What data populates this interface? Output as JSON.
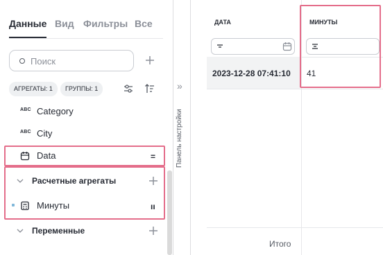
{
  "left_panel": {
    "tabs": [
      {
        "label": "Данные",
        "active": true
      },
      {
        "label": "Вид",
        "active": false
      },
      {
        "label": "Фильтры",
        "active": false
      },
      {
        "label": "Все",
        "active": false
      }
    ],
    "search": {
      "placeholder": "Поиск",
      "value": ""
    },
    "chips": [
      {
        "label": "АГРЕГАТЫ: 1"
      },
      {
        "label": "ГРУППЫ: 1"
      }
    ],
    "fields": [
      {
        "type_badge": "ABC",
        "label": "Category"
      },
      {
        "type_badge": "ABC",
        "label": "City"
      }
    ],
    "date_field": {
      "icon": "calendar-icon",
      "label": "Data",
      "mark": "="
    },
    "groups": {
      "calculated": {
        "label": "Расчетные агрегаты"
      },
      "variables": {
        "label": "Переменные"
      }
    },
    "measure_field": {
      "icon": "calculator-icon",
      "label": "Минуты",
      "mark": "ıı"
    }
  },
  "settings_panel": {
    "label": "Панель настройки",
    "icon": "chevrons-right-icon"
  },
  "table": {
    "columns": [
      {
        "header": "ДАТА",
        "filter_icon": "calendar-icon"
      },
      {
        "header": "МИНУТЫ"
      }
    ],
    "rows": [
      {
        "date": "2023-12-28 07:41:10",
        "minutes": "41"
      }
    ],
    "footer": {
      "total_label": "Итого"
    }
  },
  "colors": {
    "highlight": "#e46d8a",
    "text": "#262a33",
    "muted": "#8b8f98",
    "chip_bg": "#eef0f2",
    "row_bg": "#f2f3f4",
    "indicator": "#7fb7d9"
  }
}
